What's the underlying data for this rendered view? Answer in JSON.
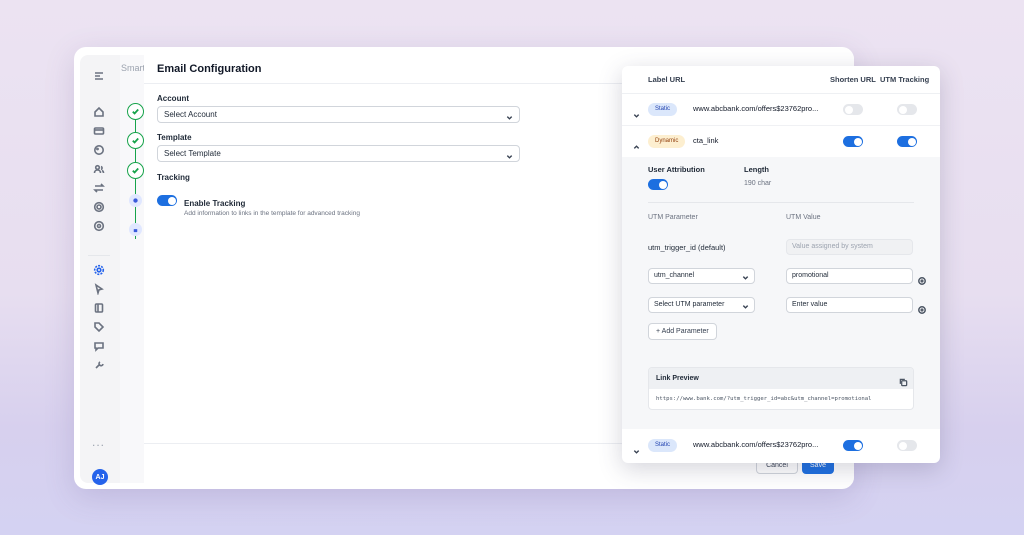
{
  "app": {
    "breadcrumb": "Smart",
    "page_title": "Email Configuration",
    "avatar_initials": "AJ",
    "more_label": "..."
  },
  "form": {
    "account_label": "Account",
    "account_select": "Select Account",
    "template_label": "Template",
    "template_select": "Select Template",
    "tracking_label": "Tracking",
    "enable_tracking_title": "Enable Tracking",
    "enable_tracking_desc": "Add information to links in the template for advanced tracking",
    "enable_tracking_on": true
  },
  "footer": {
    "cancel_label": "Cancel",
    "save_label": "Save"
  },
  "utm_panel": {
    "headers": {
      "label_url": "Label URL",
      "shorten_url": "Shorten URL",
      "utm_tracking": "UTM Tracking"
    },
    "rows": [
      {
        "badge": "Static",
        "url": "www.abcbank.com/offers$23762pro...",
        "shorten": false,
        "utm": false,
        "expanded": false
      },
      {
        "badge": "Dynamic",
        "url": "cta_link",
        "shorten": true,
        "utm": true,
        "expanded": true
      },
      {
        "badge": "Static",
        "url": "www.abcbank.com/offers$23762pro...",
        "shorten": true,
        "utm": false,
        "expanded": false
      }
    ],
    "details": {
      "user_attribution_label": "User Attribution",
      "user_attribution_on": true,
      "length_label": "Length",
      "length_value": "190 char",
      "param_header": "UTM Parameter",
      "value_header": "UTM Value",
      "params": [
        {
          "name": "utm_trigger_id (default)",
          "value": "Value assigned by system"
        },
        {
          "name": "utm_channel",
          "value": "promotional"
        },
        {
          "name": "Select UTM parameter",
          "value": "Enter value"
        }
      ],
      "add_parameter_label": "+ Add Parameter",
      "link_preview_label": "Link Preview",
      "link_preview_url": "https://www.bank.com/?utm_trigger_id=abc&utm_channel=promotional"
    }
  },
  "colors": {
    "accent": "#1d6fe0",
    "success": "#16a34a",
    "static_badge": "#dbe7fb",
    "dynamic_badge": "#fdefd0"
  }
}
